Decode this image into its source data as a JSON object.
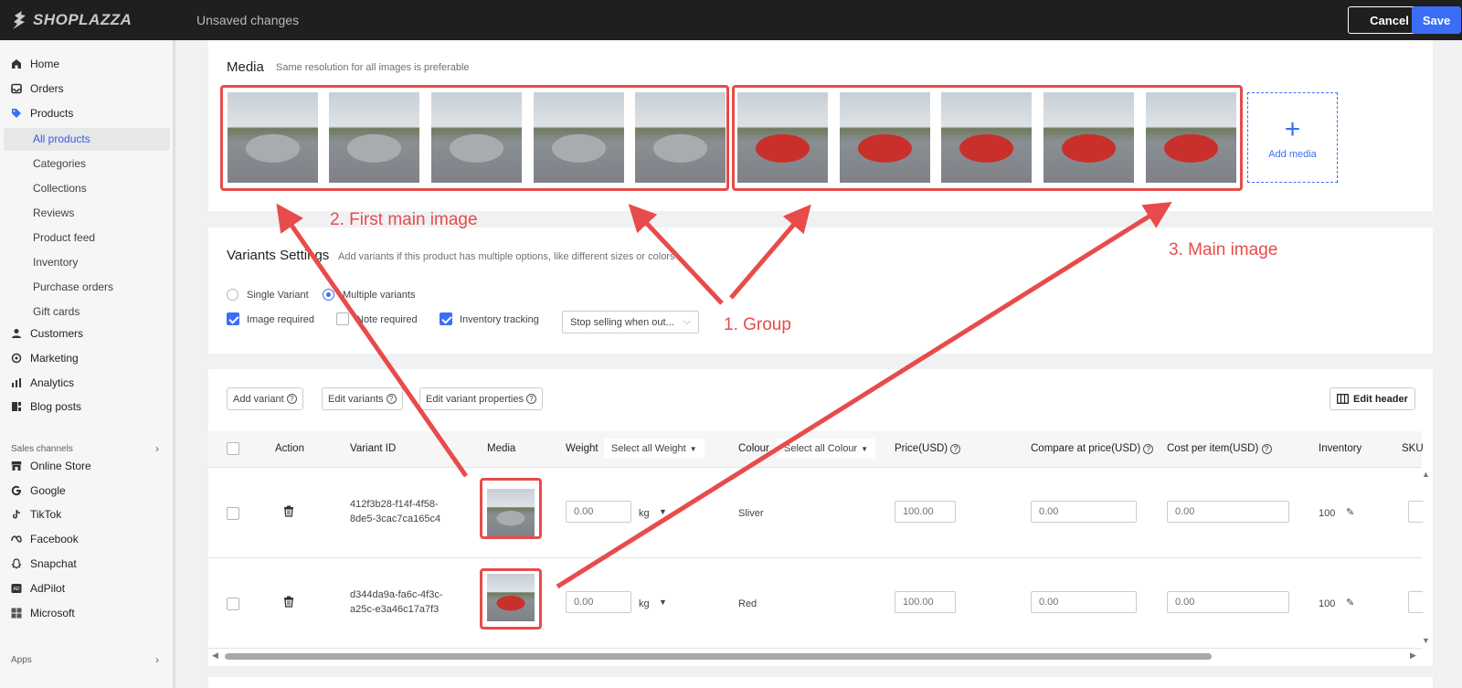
{
  "topbar": {
    "logo_text": "SHOPLAZZA",
    "status": "Unsaved changes",
    "cancel_label": "Cancel",
    "save_label": "Save",
    "accent": "#3b6ef5"
  },
  "sidebar": {
    "items": [
      {
        "label": "Home",
        "icon": "home-icon"
      },
      {
        "label": "Orders",
        "icon": "inbox-icon"
      },
      {
        "label": "Products",
        "icon": "tag-icon"
      }
    ],
    "product_sub": [
      "All products",
      "Categories",
      "Collections",
      "Reviews",
      "Product feed",
      "Inventory",
      "Purchase orders",
      "Gift cards"
    ],
    "items_after": [
      {
        "label": "Customers",
        "icon": "person-icon"
      },
      {
        "label": "Marketing",
        "icon": "target-icon"
      },
      {
        "label": "Analytics",
        "icon": "bar-chart-icon"
      },
      {
        "label": "Blog posts",
        "icon": "blog-icon"
      }
    ],
    "sales_channels_label": "Sales channels",
    "channels": [
      {
        "label": "Online Store",
        "icon": "store-icon"
      },
      {
        "label": "Google",
        "icon": "google-icon"
      },
      {
        "label": "TikTok",
        "icon": "tiktok-icon"
      },
      {
        "label": "Facebook",
        "icon": "meta-icon"
      },
      {
        "label": "Snapchat",
        "icon": "ghost-icon"
      },
      {
        "label": "AdPilot",
        "icon": "ad-icon"
      },
      {
        "label": "Microsoft",
        "icon": "windows-icon"
      }
    ],
    "apps_label": "Apps"
  },
  "media": {
    "title": "Media",
    "subtitle": "Same resolution for all images is preferable",
    "add_label": "Add media",
    "thumbnails": [
      {
        "color": "silver",
        "name": "silver-van-front"
      },
      {
        "color": "silver",
        "name": "silver-van-rear"
      },
      {
        "color": "silver",
        "name": "silver-van-roofbox"
      },
      {
        "color": "silver",
        "name": "silver-van-side"
      },
      {
        "color": "silver",
        "name": "silver-van-school"
      },
      {
        "color": "red",
        "name": "red-van-front"
      },
      {
        "color": "red",
        "name": "red-van-front2"
      },
      {
        "color": "red",
        "name": "red-van-rear"
      },
      {
        "color": "red",
        "name": "red-van-school"
      },
      {
        "color": "red",
        "name": "red-van-front3"
      }
    ]
  },
  "annotations": {
    "first_main": "2. First main image",
    "group": "1. Group",
    "main": "3. Main image",
    "color": "#e84b4b"
  },
  "variants_settings": {
    "title": "Variants Settings",
    "subtitle": "Add variants if this product has multiple options, like different sizes or colors",
    "single_label": "Single Variant",
    "multiple_label": "Multiple variants",
    "image_required": "Image required",
    "note_required": "Note required",
    "inventory_tracking": "Inventory tracking",
    "stock_policy": "Stop selling when out..."
  },
  "variants_table": {
    "add_variant": "Add variant",
    "edit_variants": "Edit variants",
    "edit_properties": "Edit variant properties",
    "edit_header": "Edit header",
    "headers": {
      "action": "Action",
      "variant_id": "Variant ID",
      "media": "Media",
      "weight": "Weight",
      "weight_select": "Select all Weight",
      "colour": "Colour",
      "colour_select": "Select all Colour",
      "price": "Price(USD)",
      "compare": "Compare at price(USD)",
      "cost": "Cost per item(USD)",
      "inventory": "Inventory",
      "sku": "SKU"
    },
    "rows": [
      {
        "id_line1": "412f3b28-f14f-4f58-",
        "id_line2": "8de5-3cac7ca165c4",
        "weight": "0.00",
        "unit": "kg",
        "colour": "Sliver",
        "price": "100.00",
        "compare": "0.00",
        "cost": "0.00",
        "inventory": "100",
        "thumb": "silver"
      },
      {
        "id_line1": "d344da9a-fa6c-4f3c-",
        "id_line2": "a25c-e3a46c17a7f3",
        "weight": "0.00",
        "unit": "kg",
        "colour": "Red",
        "price": "100.00",
        "compare": "0.00",
        "cost": "0.00",
        "inventory": "100",
        "thumb": "red"
      }
    ]
  }
}
